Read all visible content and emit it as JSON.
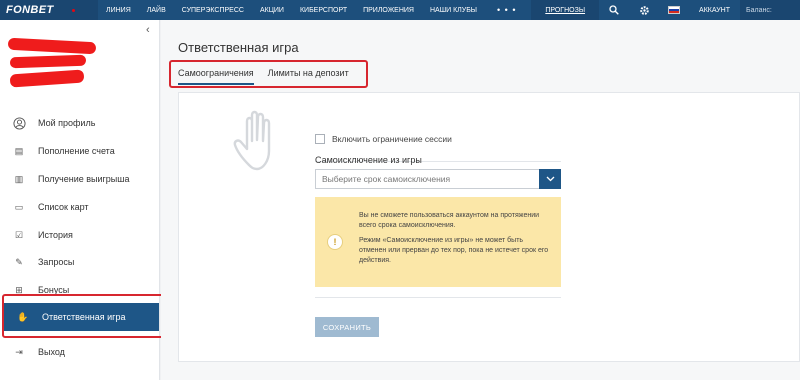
{
  "header": {
    "logo": "FONBET",
    "menu": [
      "ЛИНИЯ",
      "ЛАЙВ",
      "СУПЕРЭКСПРЕСС",
      "АКЦИИ",
      "КИБЕРСПОРТ",
      "ПРИЛОЖЕНИЯ",
      "НАШИ КЛУБЫ"
    ],
    "more": "• • •",
    "prognozy": "ПРОГНОЗЫ",
    "account": "АККАУНТ",
    "balance": "Баланс:"
  },
  "sidebar": {
    "collapse_glyph": "‹",
    "items": [
      {
        "label": "Мой профиль",
        "icon": "user-icon",
        "glyph": "◯"
      },
      {
        "label": "Пополнение счета",
        "icon": "deposit-icon",
        "glyph": "▤"
      },
      {
        "label": "Получение выигрыша",
        "icon": "withdraw-icon",
        "glyph": "▥"
      },
      {
        "label": "Список карт",
        "icon": "card-icon",
        "glyph": "▭"
      },
      {
        "label": "История",
        "icon": "history-icon",
        "glyph": "☑"
      },
      {
        "label": "Запросы",
        "icon": "requests-icon",
        "glyph": "✎"
      },
      {
        "label": "Бонусы",
        "icon": "gift-icon",
        "glyph": "⊞"
      },
      {
        "label": "Ответственная игра",
        "icon": "hand-icon",
        "glyph": "✋"
      },
      {
        "label": "Выход",
        "icon": "logout-icon",
        "glyph": "⇥"
      }
    ]
  },
  "main": {
    "title": "Ответственная игра",
    "tabs": [
      {
        "label": "Самоограничения",
        "active": true
      },
      {
        "label": "Лимиты на депозит",
        "active": false
      }
    ],
    "session_limit_label": "Включить ограничение сессии",
    "self_exclusion_label": "Самоисключение из игры",
    "select_placeholder": "Выберите срок самоисключения",
    "select_arrow": "⌄",
    "warning_icon": "!",
    "warning_p1": "Вы не сможете пользоваться аккаунтом на протяжении всего срока самоисключения.",
    "warning_p2": "Режим «Самоисключение из игры» не может быть отменен или прерван до тех пор, пока не истечет срок его действия.",
    "save_label": "СОХРАНИТЬ"
  },
  "colors": {
    "nav": "#1d4f7c",
    "accent": "#1e5687",
    "highlight": "#d7262f",
    "warning_bg": "#fbe7a8",
    "save_disabled": "#9fbad1"
  }
}
